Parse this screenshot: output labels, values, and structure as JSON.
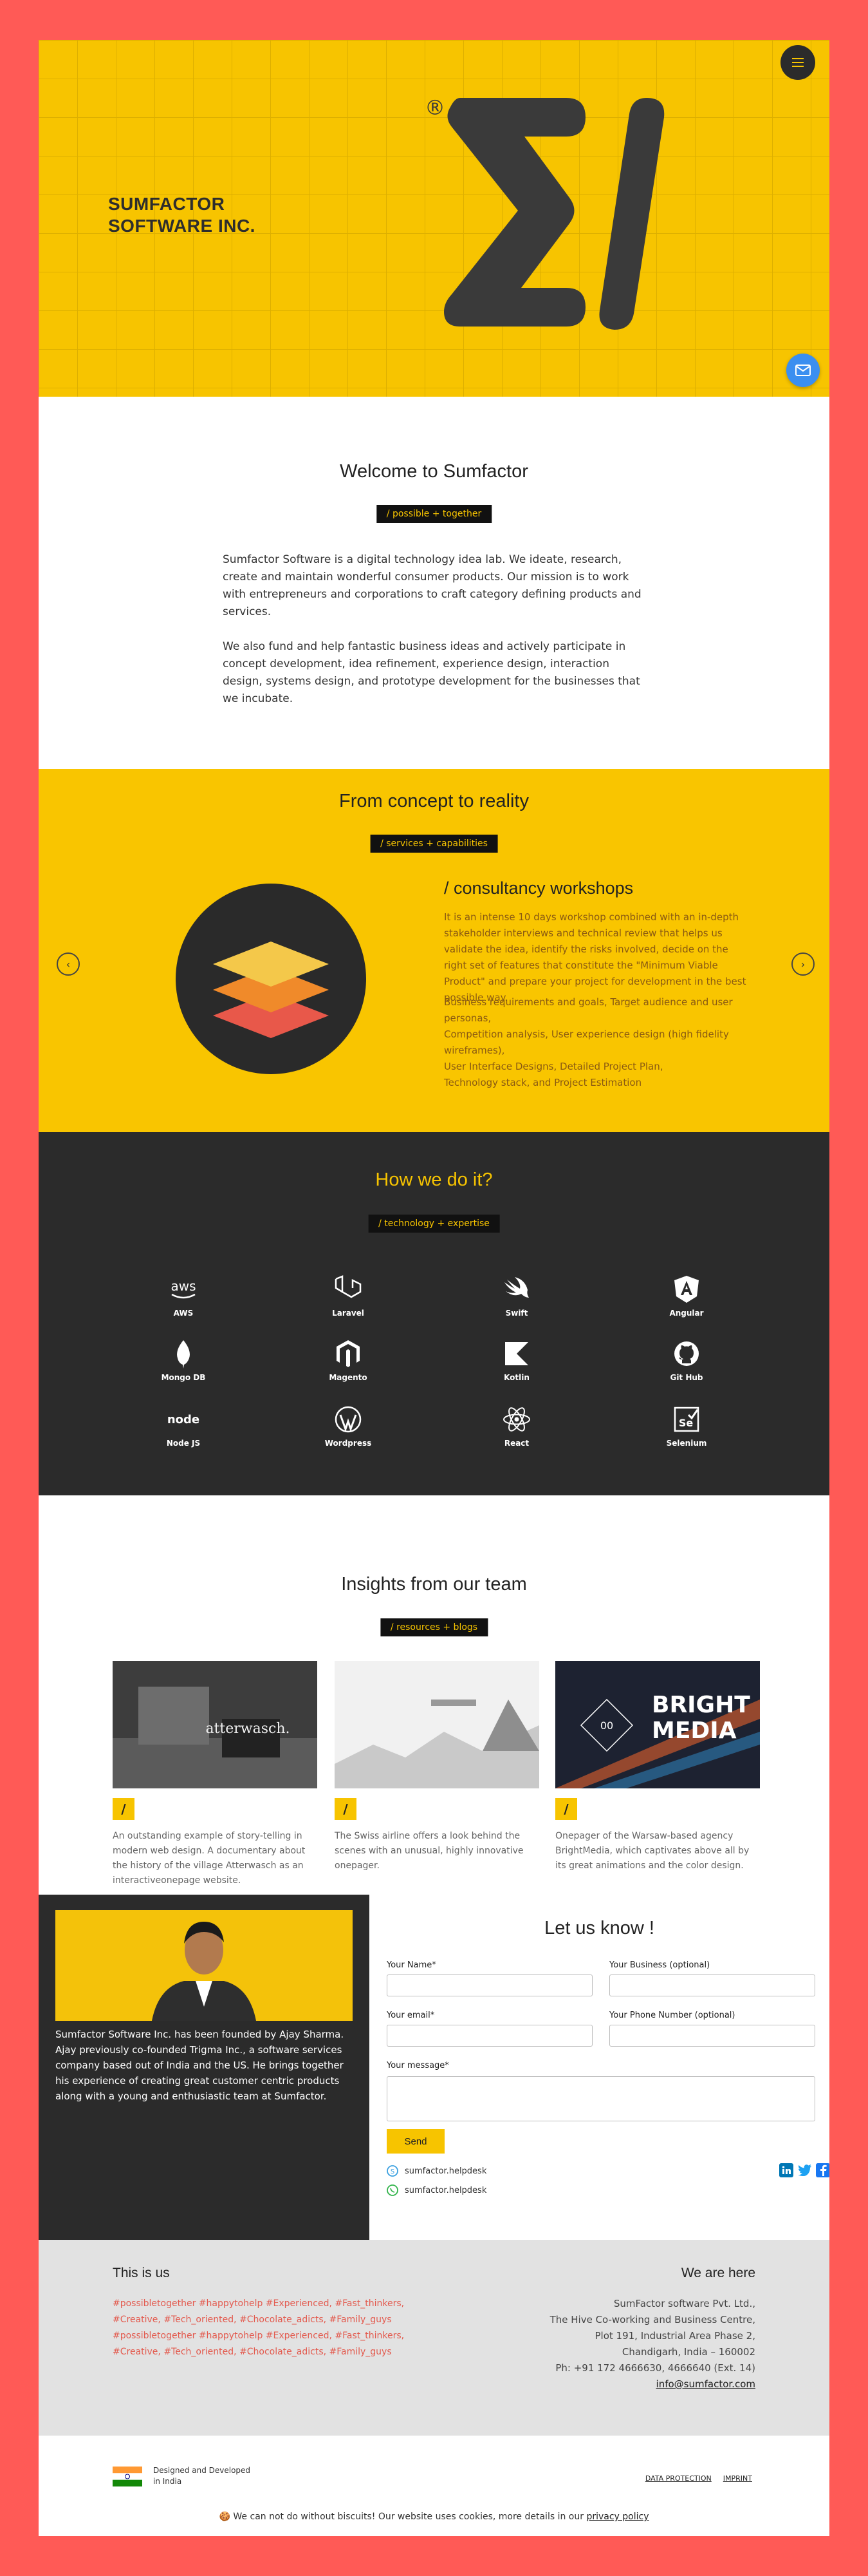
{
  "hero": {
    "brand_line1": "SUMFACTOR",
    "brand_line2": "SOFTWARE INC.",
    "registered": "®",
    "menu_icon": "hamburger-icon",
    "mail_icon": "mail-icon"
  },
  "welcome": {
    "title": "Welcome to Sumfactor",
    "tag": "/ possible + together",
    "para1": "Sumfactor Software is a digital technology idea lab. We ideate, research, create and maintain wonderful consumer products. Our mission is to work with entrepreneurs and corporations to craft category defining products and services.",
    "para2": "We also fund and help fantastic business ideas and actively participate in concept development, idea refinement, experience design, interaction design, systems design, and prototype development for the businesses that we incubate."
  },
  "concept": {
    "title": "From concept to reality",
    "tag": "/ services + capabilities",
    "workshop_title": "/ consultancy workshops",
    "workshop_text1": "It is an intense 10 days workshop combined with an in-depth stakeholder interviews and technical review that helps us validate the idea, identify the risks involved, decide on the right set of features that constitute the \"Minimum Viable Product\" and prepare your project for development in the best possible way.",
    "workshop_text2": "Business requirements and goals, Target audience and user personas,",
    "workshop_text3": "Competition analysis, User experience design (high fidelity wireframes),",
    "workshop_text4": "User Interface Designs, Detailed Project Plan,",
    "workshop_text5": "Technology stack, and Project Estimation",
    "prev_icon": "chevron-left-icon",
    "next_icon": "chevron-right-icon"
  },
  "how": {
    "title": "How we do it?",
    "tag": "/ technology + expertise",
    "techs": [
      {
        "label": "AWS",
        "icon": "aws-icon"
      },
      {
        "label": "Laravel",
        "icon": "laravel-icon"
      },
      {
        "label": "Swift",
        "icon": "swift-icon"
      },
      {
        "label": "Angular",
        "icon": "angular-icon"
      },
      {
        "label": "Mongo DB",
        "icon": "mongodb-icon"
      },
      {
        "label": "Magento",
        "icon": "magento-icon"
      },
      {
        "label": "Kotlin",
        "icon": "kotlin-icon"
      },
      {
        "label": "Git Hub",
        "icon": "github-icon"
      },
      {
        "label": "Node JS",
        "icon": "nodejs-icon"
      },
      {
        "label": "Wordpress",
        "icon": "wordpress-icon"
      },
      {
        "label": "React",
        "icon": "react-icon"
      },
      {
        "label": "Selenium",
        "icon": "selenium-icon"
      }
    ],
    "aws_text": "aws",
    "node_text": "node",
    "selenium_text": "Se"
  },
  "insights": {
    "title": "Insights from our team",
    "tag": "/ resources + blogs",
    "card_mark": "/",
    "cards": [
      {
        "text": "An outstanding example of story-telling in modern web design. A documentary about the history of the village Atterwasch as an interactiveonepage website.",
        "img_text": "atterwasch."
      },
      {
        "text": "The Swiss airline offers a look behind the scenes with an unusual, highly innovative onepager.",
        "img_text": ""
      },
      {
        "text": "Onepager of the Warsaw-based agency BrightMedia, which captivates above all by its great animations and the color design.",
        "img_text": "BRIGHT MEDIA",
        "img_text_1": "BRIGHT",
        "img_text_2": "MEDIA",
        "img_text_3": "00"
      }
    ]
  },
  "founder": {
    "bio": "Sumfactor Software Inc. has been founded by Ajay Sharma. Ajay previously co-founded Trigma Inc., a software services company based out of India and the US. He brings together his experience of creating great customer centric products along with a young and enthusiastic team at Sumfactor."
  },
  "contact": {
    "title": "Let us know !",
    "name_label": "Your Name*",
    "business_label": "Your Business (optional)",
    "email_label": "Your email*",
    "phone_label": "Your Phone Number (optional)",
    "message_label": "Your message*",
    "send_label": "Send",
    "skype": "sumfactor.helpdesk",
    "whatsapp": "sumfactor.helpdesk",
    "social": [
      "linkedin-icon",
      "twitter-icon",
      "facebook-icon"
    ],
    "colors": {
      "linkedin": "#0077b5",
      "twitter": "#1da1f2",
      "facebook": "#1877f2"
    }
  },
  "footer": {
    "this_is_us": "This is us",
    "hashtags": "#possibletogether #happytohelp #Experienced, #Fast_thinkers, #Creative, #Tech_oriented, #Chocolate_adicts, #Family_guys #possibletogether #happytohelp #Experienced, #Fast_thinkers, #Creative, #Tech_oriented, #Chocolate_adicts, #Family_guys",
    "we_are_here": "We are here",
    "addr1": "SumFactor software Pvt. Ltd.,",
    "addr2": "The Hive Co-working and Business Centre,",
    "addr3": "Plot 191, Industrial Area Phase 2,",
    "addr4": "Chandigarh, India – 160002",
    "phone": "Ph: +91 172 4666630, 4666640 (Ext. 14)",
    "email": "info@sumfactor.com",
    "made_in_1": "Designed and Developed",
    "made_in_2": "in India",
    "data_protection": "DATA PROTECTION",
    "imprint": "IMPRINT",
    "cookie_icon": "🍪",
    "cookie_text": "We can not do without biscuits! Our website uses cookies, more details in our",
    "cookie_link": "privacy policy"
  },
  "colors": {
    "accent": "#f7c400",
    "frame": "#ff5a56",
    "dark": "#2b2b2b",
    "hashtag": "#e35a4e"
  }
}
